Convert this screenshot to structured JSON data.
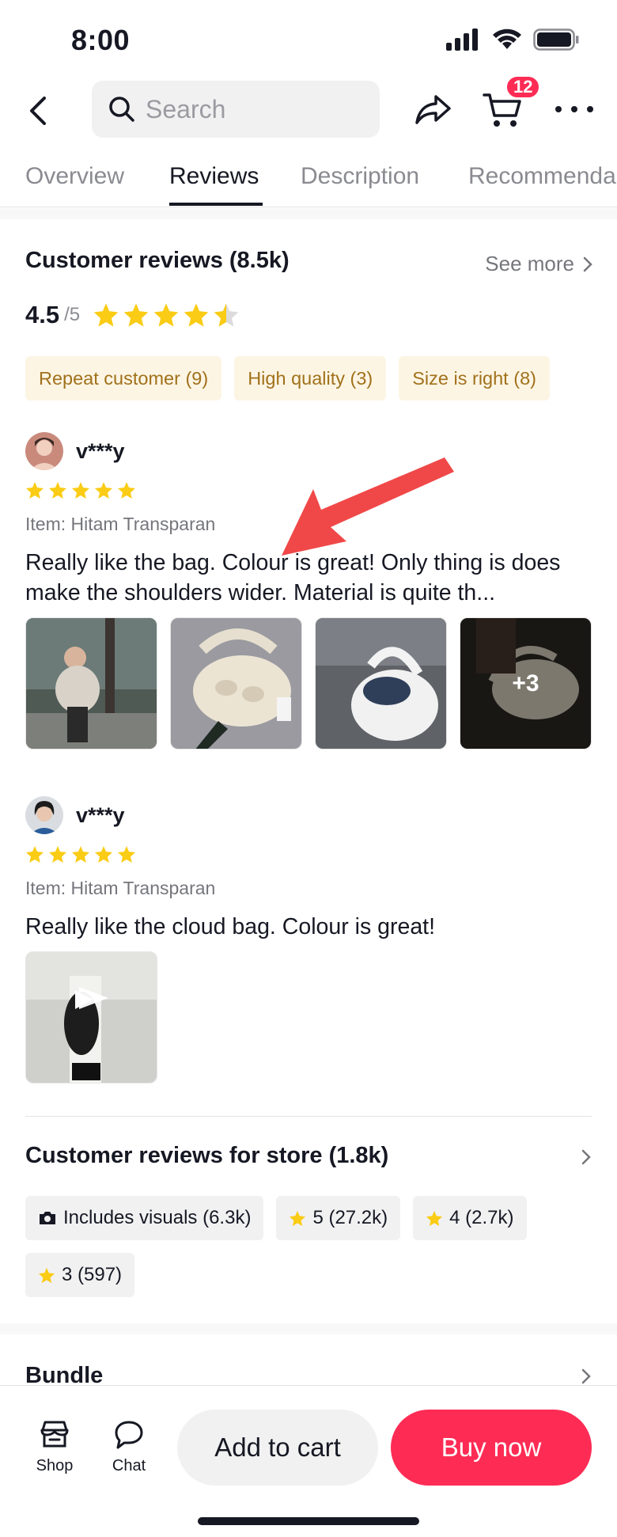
{
  "status_bar": {
    "time": "8:00"
  },
  "nav": {
    "search_placeholder": "Search",
    "cart_count": "12"
  },
  "tabs": [
    {
      "label": "Overview"
    },
    {
      "label": "Reviews"
    },
    {
      "label": "Description"
    },
    {
      "label": "Recommenda"
    }
  ],
  "reviews": {
    "title": "Customer reviews (8.5k)",
    "see_more": "See more",
    "rating": "4.5",
    "rating_scale": "/5",
    "rating_value": 4.5,
    "chips": [
      "Repeat customer (9)",
      "High quality (3)",
      "Size is right (8)"
    ],
    "items": [
      {
        "user": "v***y",
        "stars": 5,
        "item": "Item: Hitam Transparan",
        "text": "Really like the bag. Colour is great! Only thing is does make the shoulders wider. Material is quite th...",
        "more_count": "+3"
      },
      {
        "user": "v***y",
        "stars": 5,
        "item": "Item: Hitam Transparan",
        "text": "Really like the cloud bag. Colour is great!"
      }
    ]
  },
  "store_reviews": {
    "title": "Customer reviews for store (1.8k)",
    "chips": [
      "Includes visuals (6.3k)",
      "5 (27.2k)",
      "4 (2.7k)",
      "3 (597)"
    ]
  },
  "bundle": {
    "title": "Bundle"
  },
  "bottom_bar": {
    "shop": "Shop",
    "chat": "Chat",
    "add_to_cart": "Add to cart",
    "buy_now": "Buy now"
  },
  "colors": {
    "accent": "#fe2c55",
    "star": "#facc15",
    "chip_bg": "#fdf5e4",
    "chip_text": "#a0711b",
    "arrow": "#f04848"
  }
}
